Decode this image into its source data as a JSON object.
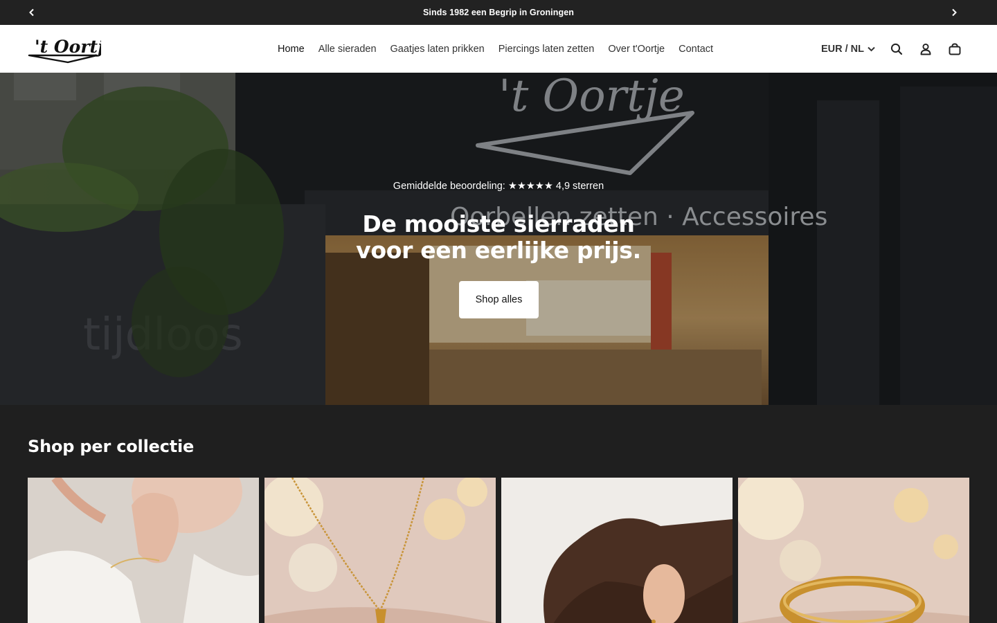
{
  "announcement": {
    "text": "Sinds 1982 een Begrip in Groningen",
    "prev_icon": "chevron-left-icon",
    "next_icon": "chevron-right-icon"
  },
  "header": {
    "logo_text": "'t Oortje",
    "nav": [
      {
        "label": "Home",
        "active": true
      },
      {
        "label": "Alle sieraden"
      },
      {
        "label": "Gaatjes laten prikken"
      },
      {
        "label": "Piercings laten zetten"
      },
      {
        "label": "Over t'Oortje"
      },
      {
        "label": "Contact"
      }
    ],
    "locale": "EUR / NL",
    "icons": [
      "search-icon",
      "account-icon",
      "cart-icon"
    ]
  },
  "hero": {
    "rating": "Gemiddelde beoordeling: ★★★★★ 4,9 sterren",
    "title_line1": "De mooiste sierraden",
    "title_line2": "voor een eerlijke prijs.",
    "button": "Shop alles",
    "sign_text": "'t Oortje",
    "window_text": "Oorbellen zetten · Accessoires",
    "window_left_text": "tijdloos"
  },
  "collections": {
    "title": "Shop per collectie"
  },
  "colors": {
    "announcement_bg": "#222222",
    "page_bg": "#1f1f1f",
    "header_bg": "#ffffff",
    "button_bg": "#ffffff"
  }
}
